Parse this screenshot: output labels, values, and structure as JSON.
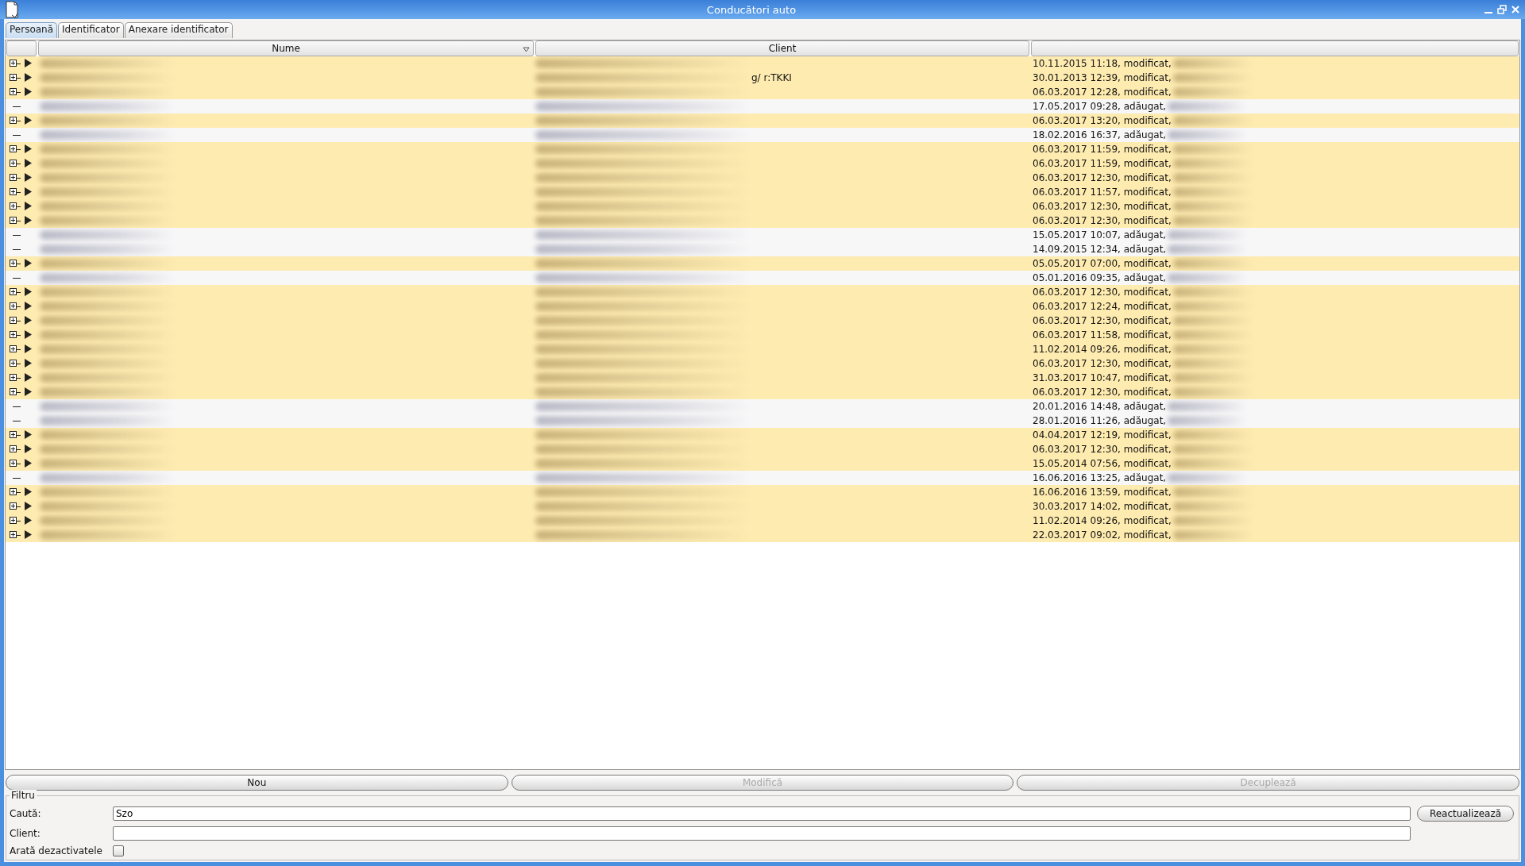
{
  "window": {
    "title": "Conducători auto"
  },
  "tabs": [
    {
      "label": "Persoană",
      "selected": true
    },
    {
      "label": "Identificator",
      "selected": false
    },
    {
      "label": "Anexare identificator",
      "selected": false
    }
  ],
  "table": {
    "columns": [
      "Nume",
      "Client"
    ],
    "rows": [
      {
        "kind": "group",
        "client": "",
        "changed": "10.11.2015 11:18, modificat,"
      },
      {
        "kind": "group",
        "client": "g/ r:TKKI",
        "changed": "30.01.2013 12:39, modificat,"
      },
      {
        "kind": "group",
        "client": "",
        "changed": "06.03.2017 12:28, modificat,"
      },
      {
        "kind": "leaf",
        "client": "",
        "changed": "17.05.2017 09:28, adăugat,"
      },
      {
        "kind": "group",
        "client": "",
        "changed": "06.03.2017 13:20, modificat,"
      },
      {
        "kind": "leaf",
        "client": "",
        "changed": "18.02.2016 16:37, adăugat,"
      },
      {
        "kind": "group",
        "client": "",
        "changed": "06.03.2017 11:59, modificat,"
      },
      {
        "kind": "group",
        "client": "",
        "changed": "06.03.2017 11:59, modificat,"
      },
      {
        "kind": "group",
        "client": "",
        "changed": "06.03.2017 12:30, modificat,"
      },
      {
        "kind": "group",
        "client": "",
        "changed": "06.03.2017 11:57, modificat,"
      },
      {
        "kind": "group",
        "client": "",
        "changed": "06.03.2017 12:30, modificat,"
      },
      {
        "kind": "group",
        "client": "",
        "changed": "06.03.2017 12:30, modificat,"
      },
      {
        "kind": "leaf",
        "client": "",
        "changed": "15.05.2017 10:07, adăugat,"
      },
      {
        "kind": "leaf",
        "client": "",
        "changed": "14.09.2015 12:34, adăugat,"
      },
      {
        "kind": "group",
        "client": "",
        "changed": "05.05.2017 07:00, modificat,"
      },
      {
        "kind": "leaf",
        "client": "",
        "changed": "05.01.2016 09:35, adăugat,"
      },
      {
        "kind": "group",
        "client": "",
        "changed": "06.03.2017 12:30, modificat,"
      },
      {
        "kind": "group",
        "client": "",
        "changed": "06.03.2017 12:24, modificat,"
      },
      {
        "kind": "group",
        "client": "",
        "changed": "06.03.2017 12:30, modificat,"
      },
      {
        "kind": "group",
        "client": "",
        "changed": "06.03.2017 11:58, modificat,"
      },
      {
        "kind": "group",
        "client": "",
        "changed": "11.02.2014 09:26, modificat,"
      },
      {
        "kind": "group",
        "client": "",
        "changed": "06.03.2017 12:30, modificat,"
      },
      {
        "kind": "group",
        "client": "",
        "changed": "31.03.2017 10:47, modificat,"
      },
      {
        "kind": "group",
        "client": "",
        "changed": "06.03.2017 12:30, modificat,"
      },
      {
        "kind": "leaf",
        "client": "",
        "changed": "20.01.2016 14:48, adăugat,"
      },
      {
        "kind": "leaf",
        "client": "",
        "changed": "28.01.2016 11:26, adăugat,"
      },
      {
        "kind": "group",
        "client": "",
        "changed": "04.04.2017 12:19, modificat,"
      },
      {
        "kind": "group",
        "client": "",
        "changed": "06.03.2017 12:30, modificat,"
      },
      {
        "kind": "group",
        "client": "",
        "changed": "15.05.2014 07:56, modificat,"
      },
      {
        "kind": "leaf",
        "client": "",
        "changed": "16.06.2016 13:25, adăugat,"
      },
      {
        "kind": "group",
        "client": "",
        "changed": "16.06.2016 13:59, modificat,"
      },
      {
        "kind": "group",
        "client": "",
        "changed": "30.03.2017 14:02, modificat,"
      },
      {
        "kind": "group",
        "client": "",
        "changed": "11.02.2014 09:26, modificat,"
      },
      {
        "kind": "group",
        "client": "",
        "changed": "22.03.2017 09:02, modificat,"
      }
    ]
  },
  "buttons": [
    {
      "label": "Nou",
      "disabled": false
    },
    {
      "label": "Modifică",
      "disabled": true
    },
    {
      "label": "Decuplează",
      "disabled": true
    }
  ],
  "filter": {
    "title": "Filtru",
    "search": {
      "label": "Caută:",
      "value": "Szo"
    },
    "client": {
      "label": "Client:"
    },
    "show_disabled": {
      "label": "Arată dezactivatele",
      "checked": false
    },
    "refresh_button": "Reactualizează"
  }
}
